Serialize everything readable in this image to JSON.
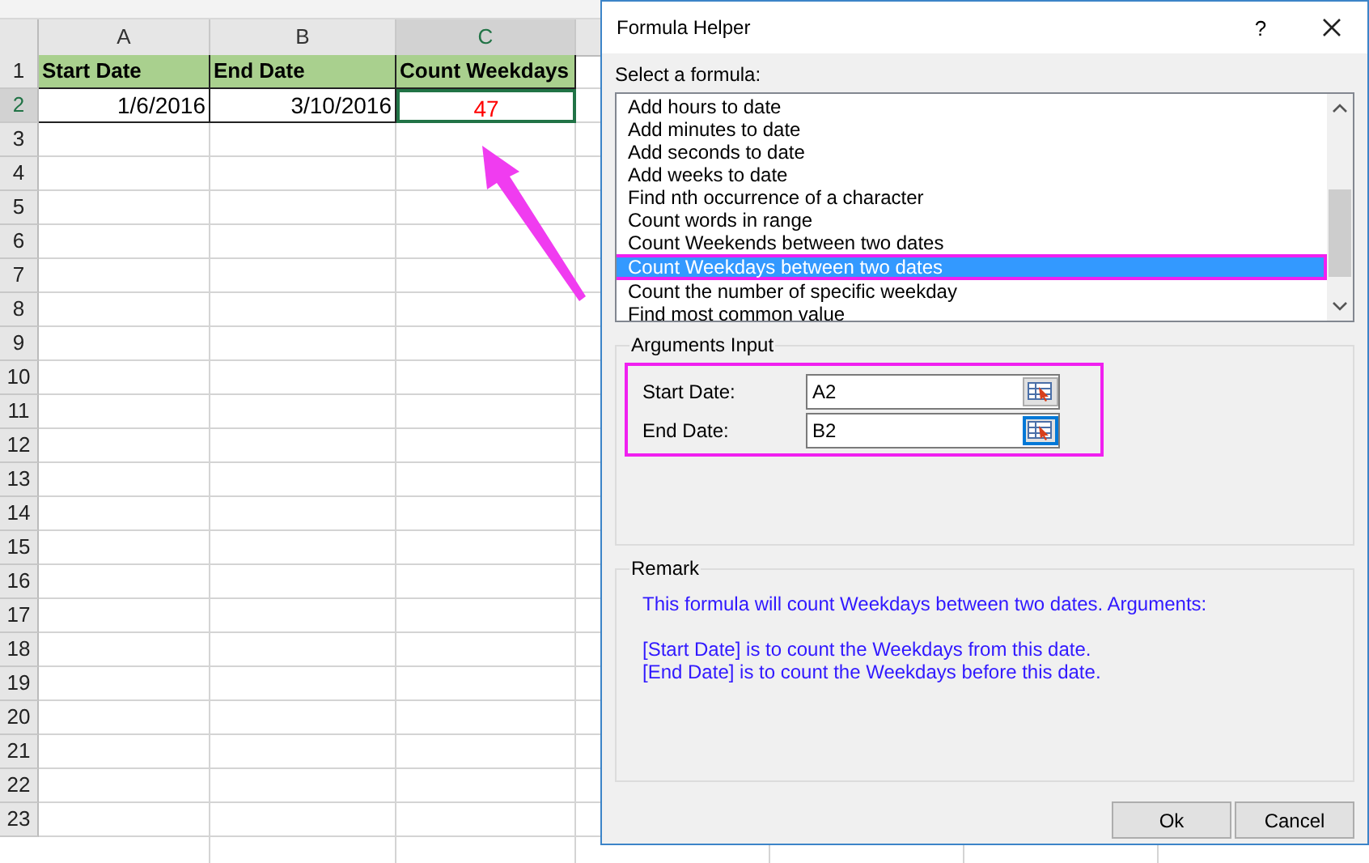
{
  "sheet": {
    "columns": [
      {
        "label": "A",
        "selected": false
      },
      {
        "label": "B",
        "selected": false
      },
      {
        "label": "C",
        "selected": true
      }
    ],
    "rows": [
      {
        "label": "1",
        "selected": false,
        "cells": [
          {
            "text": "Start Date",
            "kind": "heading"
          },
          {
            "text": "End Date",
            "kind": "heading"
          },
          {
            "text": "Count Weekdays",
            "kind": "heading"
          }
        ]
      },
      {
        "label": "2",
        "selected": true,
        "cells": [
          {
            "text": "1/6/2016",
            "kind": "date"
          },
          {
            "text": "3/10/2016",
            "kind": "date"
          },
          {
            "text": "47",
            "kind": "result"
          }
        ]
      },
      {
        "label": "3",
        "selected": false
      },
      {
        "label": "4",
        "selected": false
      },
      {
        "label": "5",
        "selected": false
      },
      {
        "label": "6",
        "selected": false
      },
      {
        "label": "7",
        "selected": false
      },
      {
        "label": "8",
        "selected": false
      },
      {
        "label": "9",
        "selected": false
      },
      {
        "label": "10",
        "selected": false
      },
      {
        "label": "11",
        "selected": false
      },
      {
        "label": "12",
        "selected": false
      },
      {
        "label": "13",
        "selected": false
      },
      {
        "label": "14",
        "selected": false
      },
      {
        "label": "15",
        "selected": false
      },
      {
        "label": "16",
        "selected": false
      },
      {
        "label": "17",
        "selected": false
      },
      {
        "label": "18",
        "selected": false
      },
      {
        "label": "19",
        "selected": false
      },
      {
        "label": "20",
        "selected": false
      },
      {
        "label": "21",
        "selected": false
      },
      {
        "label": "22",
        "selected": false
      },
      {
        "label": "23",
        "selected": false
      }
    ]
  },
  "dialog": {
    "title": "Formula Helper",
    "help": "?",
    "list_label": "Select a formula:",
    "formulas": [
      {
        "label": "Add hours to date",
        "selected": false
      },
      {
        "label": "Add minutes to date",
        "selected": false
      },
      {
        "label": "Add seconds to date",
        "selected": false
      },
      {
        "label": "Add weeks to date",
        "selected": false
      },
      {
        "label": "Find nth occurrence of a character",
        "selected": false
      },
      {
        "label": "Count words in range",
        "selected": false
      },
      {
        "label": "Count Weekends between two dates",
        "selected": false
      },
      {
        "label": "Count Weekdays between two dates",
        "selected": true
      },
      {
        "label": "Count the number of specific weekday",
        "selected": false
      },
      {
        "label": "Find most common value",
        "selected": false
      }
    ],
    "arguments": {
      "title": "Arguments Input",
      "fields": [
        {
          "label": "Start Date:",
          "value": "A2",
          "focused": false
        },
        {
          "label": "End Date:",
          "value": "B2",
          "focused": true
        }
      ]
    },
    "remark": {
      "title": "Remark",
      "intro": "This formula will count Weekdays between two dates. Arguments:",
      "lines": [
        "[Start Date] is to count the Weekdays from this date.",
        "[End Date] is to count the Weekdays before this date."
      ]
    },
    "buttons": [
      "Ok",
      "Cancel"
    ]
  }
}
